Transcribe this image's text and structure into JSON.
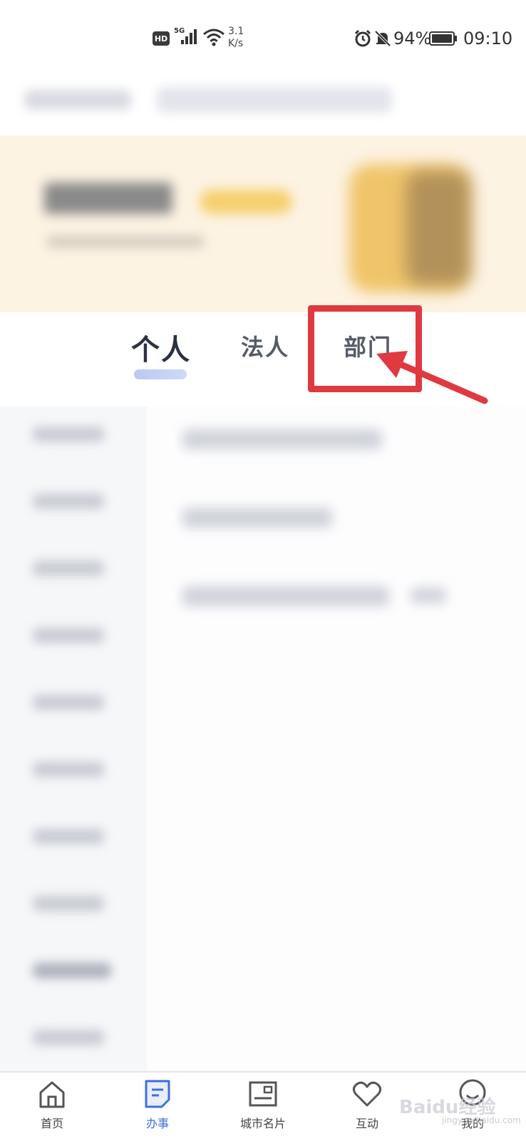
{
  "status_bar": {
    "hd": "HD",
    "network": "5G",
    "speed_value": "3.1",
    "speed_unit": "K/s",
    "battery": "94%",
    "time": "09:10"
  },
  "tabs": [
    {
      "label": "个人",
      "active": true
    },
    {
      "label": "法人",
      "active": false
    },
    {
      "label": "部门",
      "active": false
    }
  ],
  "bottom_nav": [
    {
      "label": "首页",
      "icon": "home-icon",
      "active": false
    },
    {
      "label": "办事",
      "icon": "document-icon",
      "active": true
    },
    {
      "label": "城市名片",
      "icon": "city-card-icon",
      "active": false
    },
    {
      "label": "互动",
      "icon": "heart-icon",
      "active": false
    },
    {
      "label": "我的",
      "icon": "profile-icon",
      "active": false
    }
  ],
  "watermark": {
    "text": "Baidu经验",
    "url": "jingyan.baidu.com"
  },
  "colors": {
    "accent": "#3d6fe0",
    "annotation": "#e0393f",
    "banner_bg": "#fdf3e3"
  }
}
